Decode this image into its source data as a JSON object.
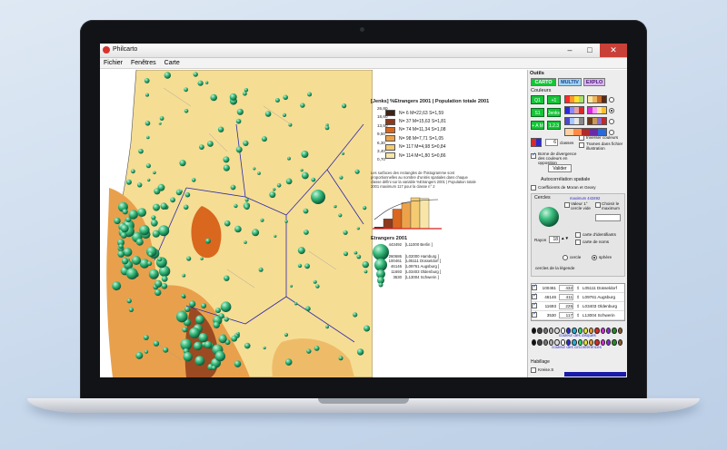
{
  "window": {
    "title": "Philcarto"
  },
  "menu": [
    "Fichier",
    "Fenêtres",
    "Carte"
  ],
  "legend": {
    "title": "[Jenks] %Etrangers 2001 | Population totale 2001",
    "classes": [
      {
        "stats": "N= 6  M=22,63  S=1,59",
        "color": "#3d2216"
      },
      {
        "stats": "N= 37  M=15,63  S=1,81",
        "color": "#8c3a1e"
      },
      {
        "stats": "N= 74  M=11,34  S=1,08",
        "color": "#d9671e"
      },
      {
        "stats": "N= 98  M=7,71  S=1,05",
        "color": "#eda24a"
      },
      {
        "stats": "N= 117  M=4,98  S=0,84",
        "color": "#f4cb72"
      },
      {
        "stats": "N= 114  M=1,80  S=0,86",
        "color": "#f7e6a8"
      }
    ],
    "bounds": [
      "26,80",
      "18,60",
      "13,50",
      "9,50",
      "6,30",
      "3,40",
      "0,70"
    ],
    "note": "Les surfaces des rectangles de l'histogramme sont proportionnelles au nombre d'unités spatiales dans chaque classe défini sur la variable %Etrangers 2001 | Population totale 2001 maximum 117 pour la classe n° 2",
    "circles_title": "Etrangers 2001",
    "circles": [
      {
        "value": "443492",
        "label": "[L11000 Berlin ]"
      },
      {
        "value": "260686",
        "label": "[L02000 Hamburg ]"
      },
      {
        "value": "100461",
        "label": "[L05111 Düsseldorf ]"
      },
      {
        "value": "46146",
        "label": "[L09761 Augsburg ]"
      },
      {
        "value": "11693",
        "label": "[L03403 Oldenburg ]"
      },
      {
        "value": "3530",
        "label": "[L13004 Schwerin ]"
      }
    ]
  },
  "panel": {
    "outils": "Outils",
    "modes": [
      "CARTO",
      "MULTIV",
      "EXPLO"
    ],
    "couleurs": "Couleurs",
    "green_buttons": [
      "Q1",
      "+1",
      "S1",
      "Jenks",
      "+ A M",
      "1.2.3"
    ],
    "classes_value": "6",
    "classes_label": "classes",
    "inverser": "Inverser couleurs",
    "trames": "Trames dans fichier illustration",
    "borne": "Borne de divergence des couleurs en opposition",
    "valider": "Valider",
    "autocorr": "Autocorrélation spatiale",
    "moran": "Coefficients de Moran et Geary",
    "cercles": "Cercles",
    "max_value": "maximum 443492",
    "valeur": "Valeur 1° cercle vide",
    "choisir": "Choisir le maximum",
    "rayon_label": "Rayon",
    "rayon_value": "18",
    "carte_identifiants": "carte d'identifiants",
    "carte_noms": "carte de noms",
    "cercle": "cercle",
    "sphere": "sphère",
    "legend_circles_label": "cercles de la légende",
    "legend_rows": [
      {
        "n": "100461",
        "r": "432",
        "code": "L05111 Düsseldorf"
      },
      {
        "n": "46146",
        "r": "411",
        "code": "L09761 Augsburg"
      },
      {
        "n": "11693",
        "r": "225",
        "code": "L03403 Oldenburg"
      },
      {
        "n": "3530",
        "r": "117",
        "code": "L13004 Schwerin"
      }
    ],
    "couleur_disques": "couleur des disques",
    "couleur_circ": "couleur des circonférences",
    "habillage": "Habillage",
    "kreise": "Kreise.S"
  },
  "histogram": {
    "class_counts": [
      6,
      37,
      74,
      98,
      117,
      114
    ]
  },
  "colors": {
    "accent_green": "#16c438",
    "close_red": "#c94038"
  }
}
